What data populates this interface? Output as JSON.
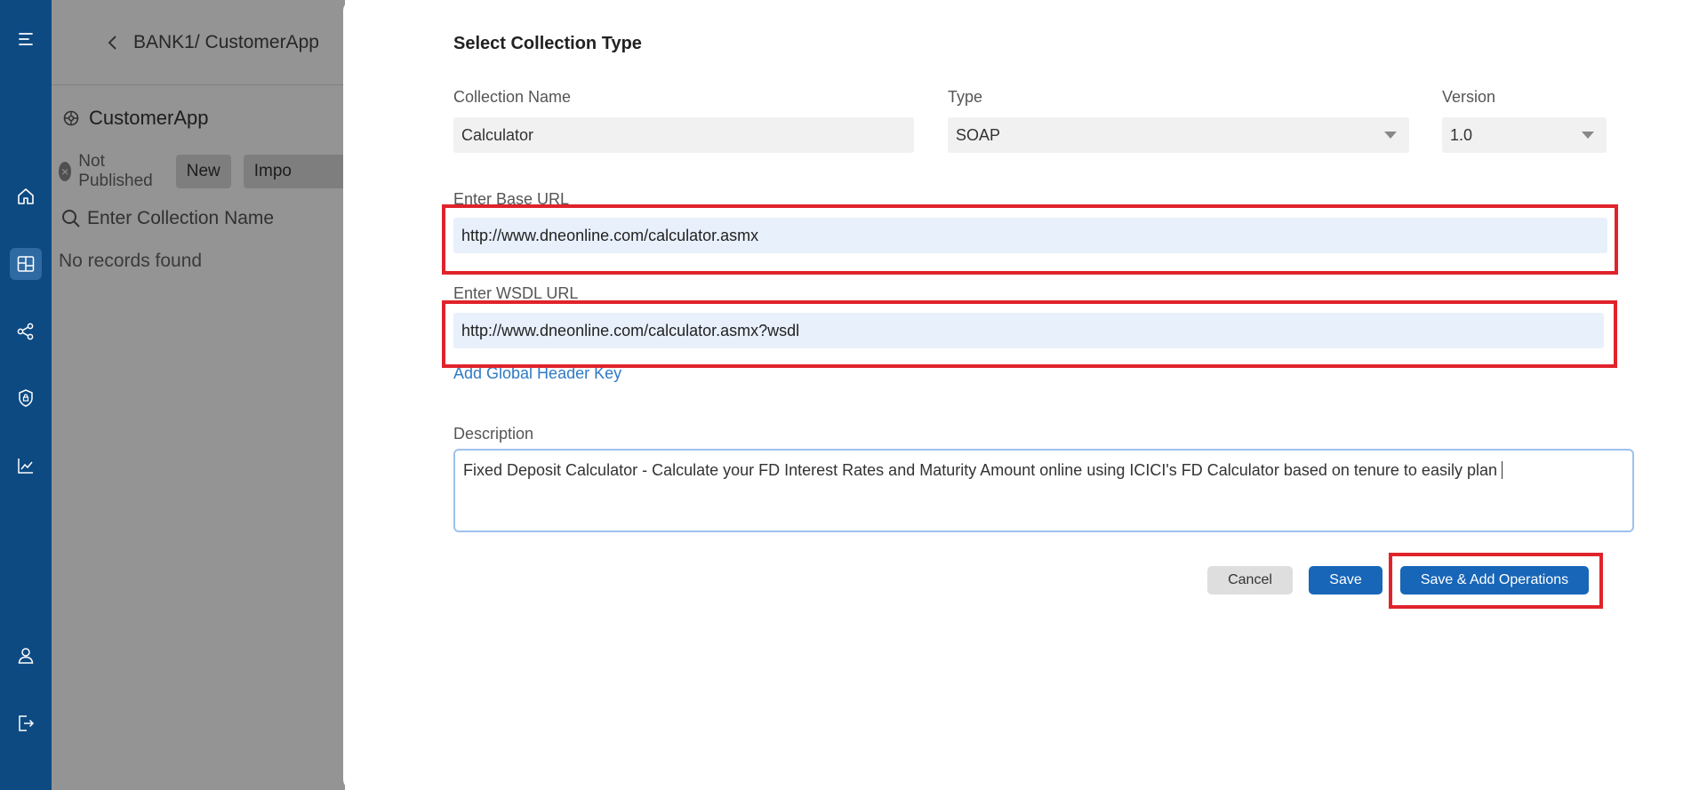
{
  "colors": {
    "rail": "#0d4a82",
    "primary": "#1766b8",
    "highlight": "#e0232b",
    "link": "#2f7ac4"
  },
  "nav_icons": [
    "menu-icon",
    "home-icon",
    "dashboard-icon",
    "share-icon",
    "shield-icon",
    "chart-icon",
    "user-icon",
    "logout-icon"
  ],
  "background_app": {
    "breadcrumb": "BANK1/ CustomerApp",
    "app_title": "CustomerApp",
    "status": "Not Published",
    "new_button": "New",
    "import_button": "Impo",
    "search_placeholder": "Enter Collection Name",
    "empty_text": "No records found"
  },
  "drawer": {
    "title": "Select Collection Type",
    "collection_name": {
      "label": "Collection Name",
      "value": "Calculator"
    },
    "type": {
      "label": "Type",
      "value": "SOAP"
    },
    "version": {
      "label": "Version",
      "value": "1.0"
    },
    "base_url": {
      "label": "Enter Base URL",
      "value": "http://www.dneonline.com/calculator.asmx"
    },
    "wsdl_url": {
      "label": "Enter WSDL URL",
      "value": "http://www.dneonline.com/calculator.asmx?wsdl"
    },
    "add_header_link": "Add Global Header Key",
    "description": {
      "label": "Description",
      "value": "Fixed Deposit Calculator - Calculate your FD Interest Rates and Maturity Amount online using ICICI's FD Calculator based on tenure to easily plan"
    },
    "buttons": {
      "cancel": "Cancel",
      "save": "Save",
      "save_add_operations": "Save & Add Operations"
    }
  }
}
